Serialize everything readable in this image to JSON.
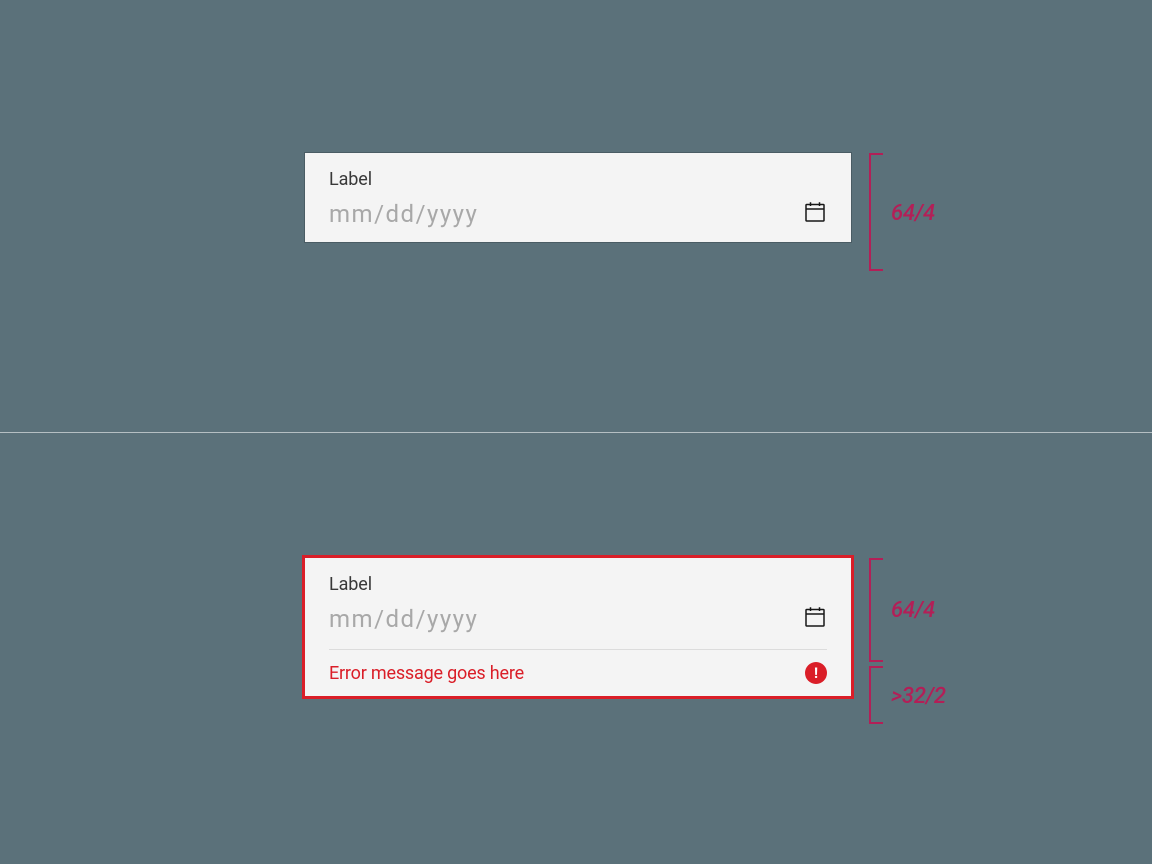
{
  "colors": {
    "error": "#da1e28",
    "annotation": "#b31f57",
    "field_bg": "#f4f4f4",
    "placeholder": "#a8a8a8",
    "label": "#393939"
  },
  "default_state": {
    "label": "Label",
    "placeholder": "mm/dd/yyyy",
    "dimension": "64/4"
  },
  "error_state": {
    "label": "Label",
    "placeholder": "mm/dd/yyyy",
    "error_message": "Error message goes here",
    "error_icon_glyph": "!",
    "dimension_field": "64/4",
    "dimension_error": ">32/2"
  }
}
